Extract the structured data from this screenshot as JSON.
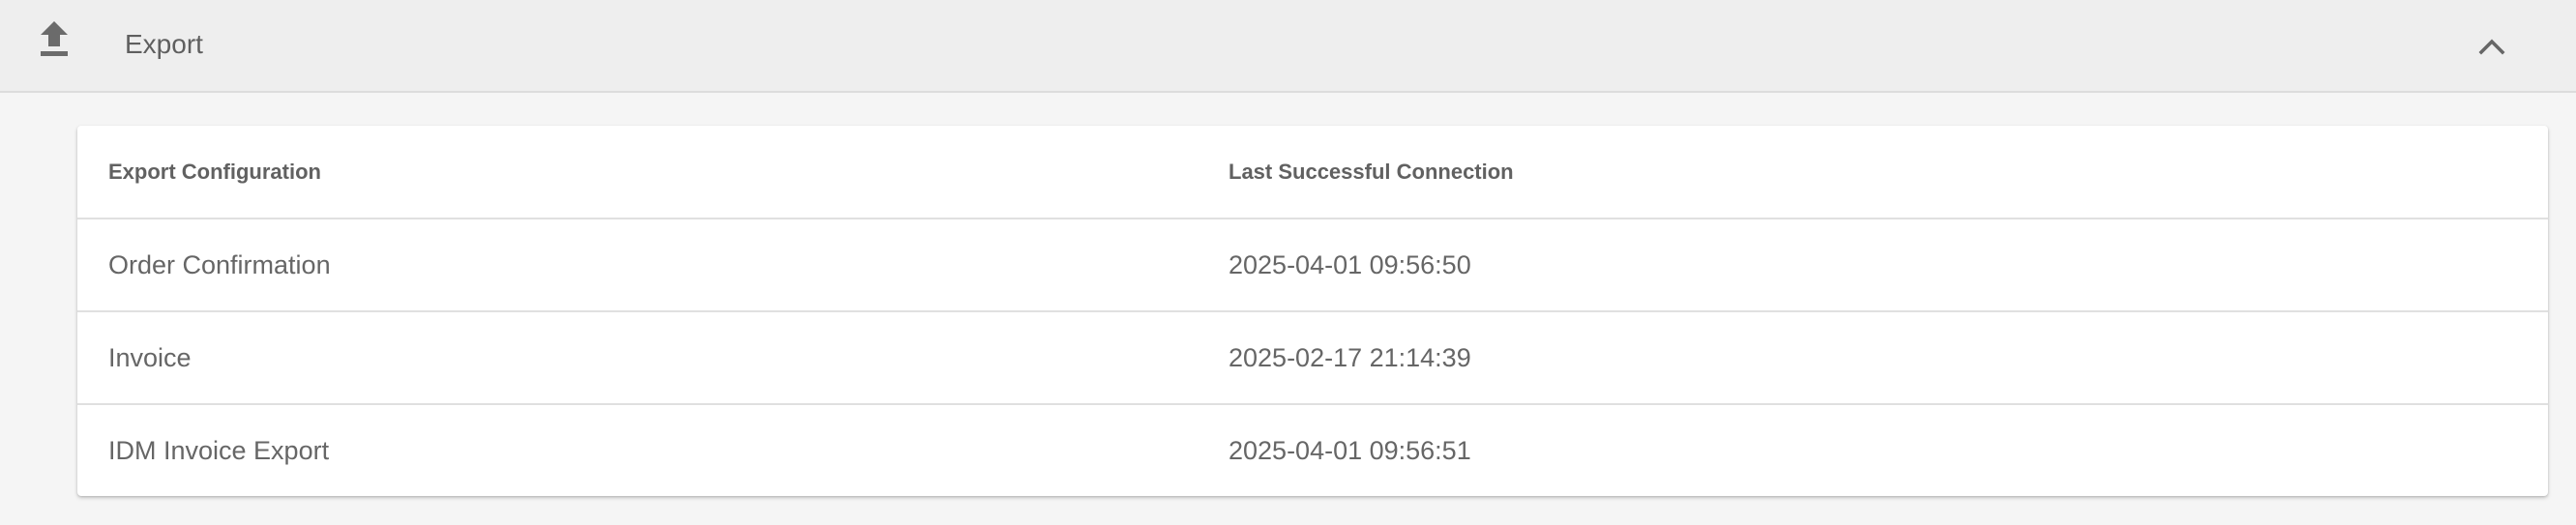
{
  "panel": {
    "title": "Export",
    "icon": "upload-icon",
    "collapse_icon": "chevron-up-icon",
    "header_bg": "#eeeeee"
  },
  "table": {
    "columns": [
      "Export Configuration",
      "Last Successful Connection"
    ],
    "rows": [
      {
        "name": "Order Confirmation",
        "last_connection": "2025-04-01 09:56:50"
      },
      {
        "name": "Invoice",
        "last_connection": "2025-02-17 21:14:39"
      },
      {
        "name": "IDM Invoice Export",
        "last_connection": "2025-04-01 09:56:51"
      }
    ]
  }
}
